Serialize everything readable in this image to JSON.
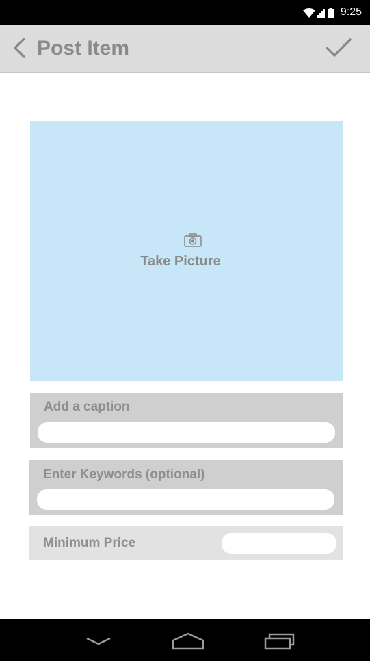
{
  "status_bar": {
    "time": "9:25",
    "icons": [
      "wifi-icon",
      "signal-icon",
      "battery-icon"
    ]
  },
  "app_bar": {
    "title": "Post Item",
    "back_icon": "chevron-left-icon",
    "confirm_icon": "checkmark-icon"
  },
  "photo": {
    "icon": "camera-icon",
    "label": "Take Picture"
  },
  "form": {
    "caption": {
      "label": "Add a caption",
      "value": ""
    },
    "keywords": {
      "label": "Enter Keywords (optional)",
      "value": ""
    },
    "min_price": {
      "label": "Minimum Price",
      "value": ""
    }
  },
  "nav_bar": {
    "icons": [
      "nav-back-icon",
      "nav-home-icon",
      "nav-recents-icon"
    ]
  },
  "colors": {
    "app_bar_bg": "#dcdcdc",
    "photo_bg": "#c7e7f8",
    "field_bg": "#cfcfcf",
    "price_bg": "#e2e2e2",
    "label_text": "#8a8a8a",
    "system_bar": "#000000"
  }
}
